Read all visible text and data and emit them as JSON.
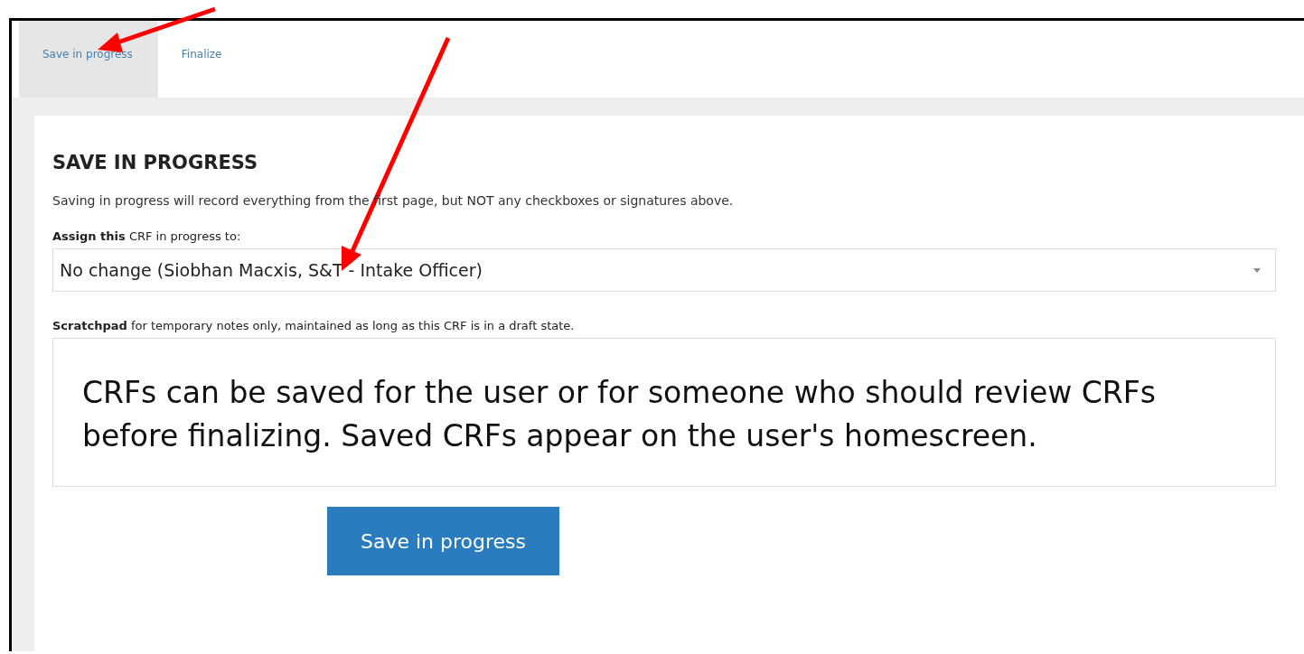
{
  "tabs": [
    {
      "label": "Save in progress",
      "selected": true
    },
    {
      "label": "Finalize",
      "selected": false
    }
  ],
  "section": {
    "title": "SAVE IN PROGRESS",
    "description": "Saving in progress will record everything from the first page, but NOT any checkboxes or signatures above.",
    "assign_label": "**Assign this** CRF in progress to:",
    "assign_value": "No change (Siobhan Macxis, S&T - Intake Officer)",
    "scratchpad_label": "**Scratchpad** for temporary notes only, maintained as long as this CRF is in a draft state.",
    "callout": "CRFs can be saved for the user or for someone who should review CRFs before finalizing. Saved CRFs appear on the user's homescreen.",
    "button": "Save in progress"
  }
}
